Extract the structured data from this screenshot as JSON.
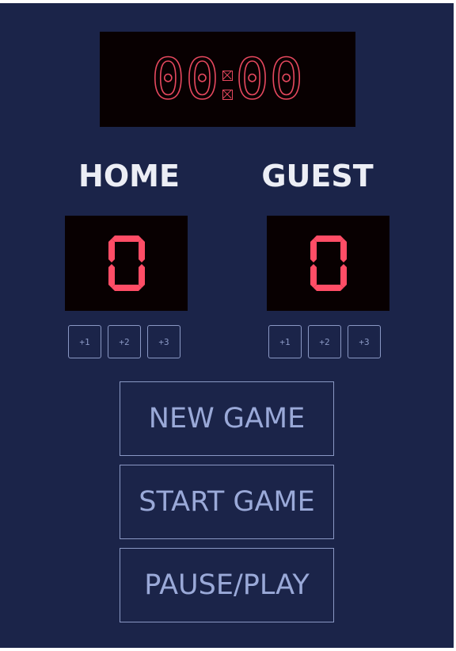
{
  "timer": {
    "minutes": "00",
    "seconds": "00"
  },
  "home": {
    "label": "HOME",
    "score": "0",
    "buttons": [
      "+1",
      "+2",
      "+3"
    ]
  },
  "guest": {
    "label": "GUEST",
    "score": "0",
    "buttons": [
      "+1",
      "+2",
      "+3"
    ]
  },
  "controls": {
    "new_game": "NEW GAME",
    "start_game": "START GAME",
    "pause_play": "PAUSE/PLAY"
  },
  "colors": {
    "background": "#1b2449",
    "display_bg": "#080001",
    "digit": "#ff4d66",
    "button_outline": "#8a98c4",
    "label": "#eceef5"
  }
}
